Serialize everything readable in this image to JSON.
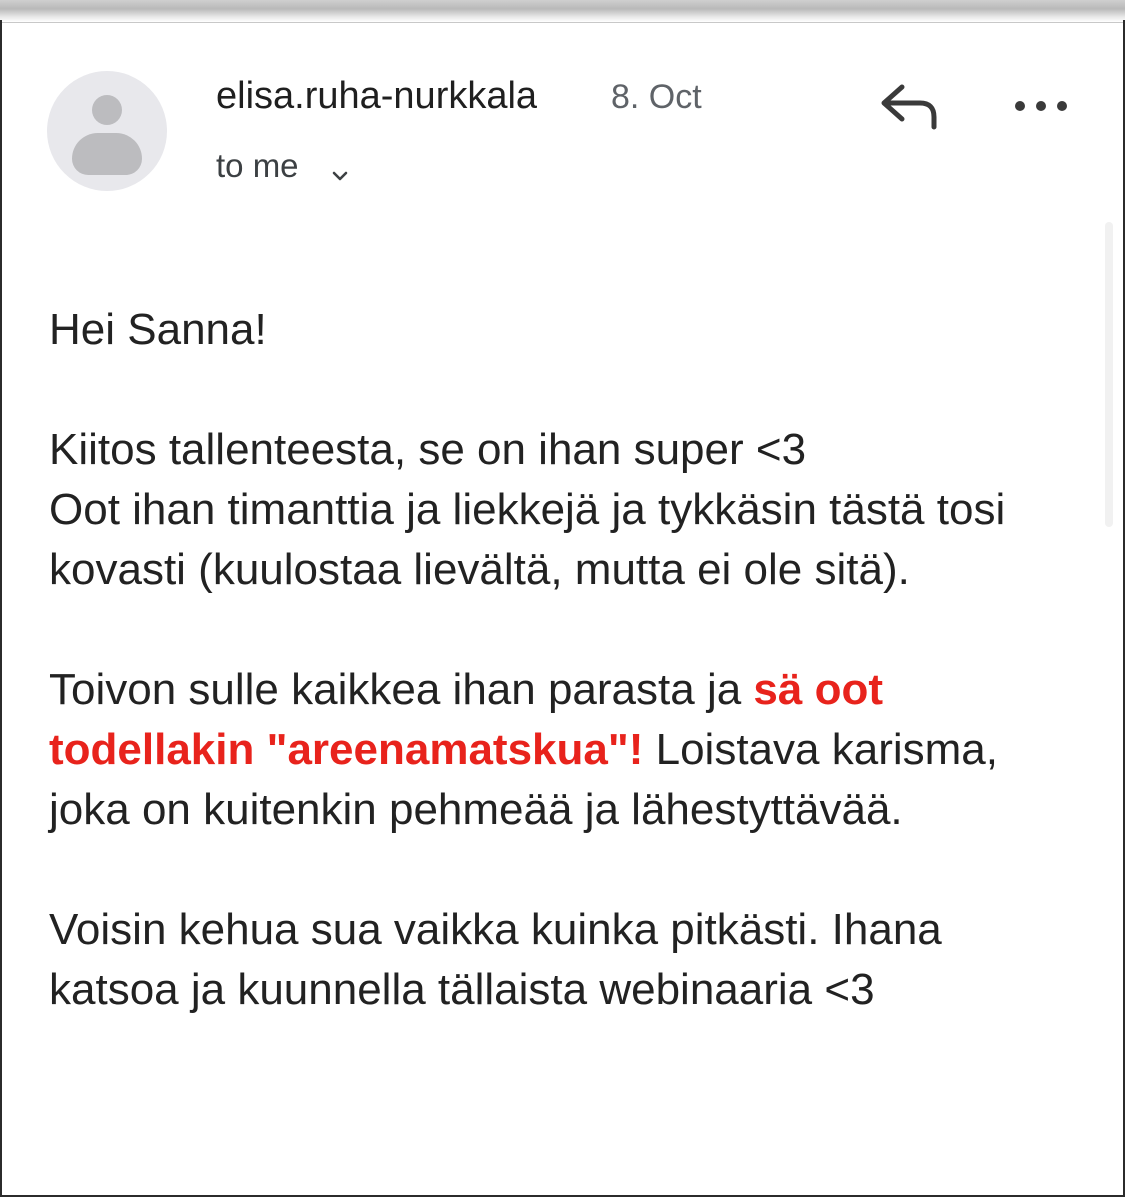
{
  "message": {
    "sender": "elisa.ruha-nurkkala",
    "date": "8. Oct",
    "recipient_label": "to me"
  },
  "icons": {
    "avatar": "person-avatar-icon",
    "reply": "reply-arrow-icon",
    "more": "more-options-icon",
    "expand": "chevron-down-icon"
  },
  "body": {
    "greeting": "Hei Sanna!",
    "para1_line1": "Kiitos tallenteesta, se on ihan super <3",
    "para1_line2": "Oot ihan timanttia ja liekkejä ja tykkäsin tästä tosi kovasti (kuulostaa lievältä, mutta ei ole sitä).",
    "para2_before": "Toivon sulle kaikkea ihan parasta ja ",
    "para2_highlight": "sä oot todellakin \"areenamatskua\"!",
    "para2_after": " Loistava karisma, joka on kuitenkin pehmeää ja lähestyttävää.",
    "para3": "Voisin kehua sua vaikka kuinka pitkästi. Ihana katsoa ja kuunnella tällaista webinaaria <3"
  },
  "colors": {
    "highlight": "#e8231c",
    "secondary_text": "#5f6368",
    "avatar_bg": "#e8e8ec"
  }
}
